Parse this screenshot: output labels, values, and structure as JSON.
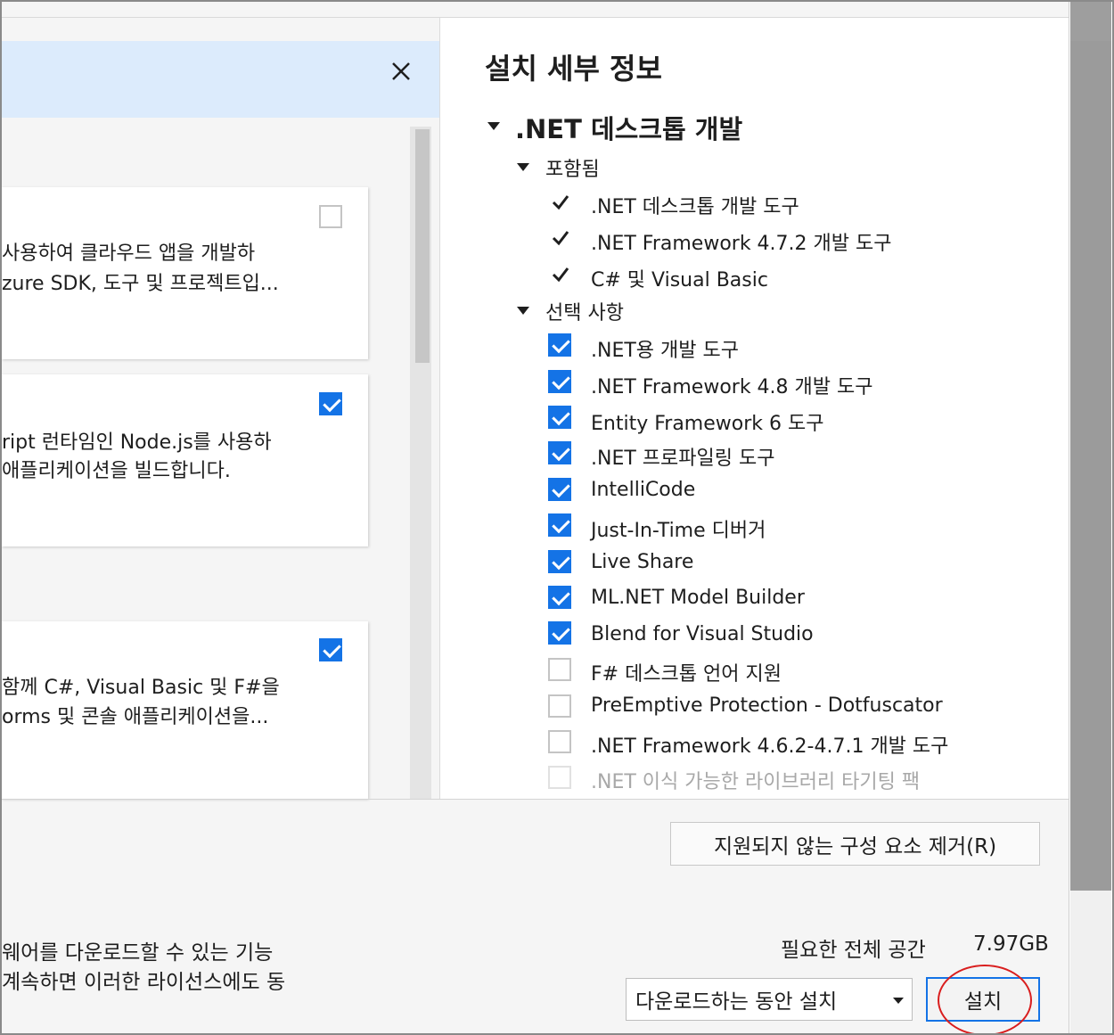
{
  "left": {
    "cards": [
      {
        "lines": [
          "사용하여 클라우드 앱을 개발하",
          "zure SDK, 도구 및 프로젝트입..."
        ],
        "checked": false
      },
      {
        "lines": [
          "ript 런타임인 Node.js를 사용하",
          "애플리케이션을 빌드합니다."
        ],
        "checked": true
      },
      {
        "lines": [
          "함께 C#, Visual Basic 및 F#을",
          "orms 및 콘솔 애플리케이션을..."
        ],
        "checked": true
      }
    ],
    "license_lines": [
      "웨어를 다운로드할 수 있는 기능",
      "계속하면 이러한 라이선스에도 동"
    ]
  },
  "details": {
    "title": "설치 세부 정보",
    "group": ".NET 데스크톱 개발",
    "included_label": "포함됨",
    "included": [
      ".NET 데스크톱 개발 도구",
      ".NET Framework 4.7.2 개발 도구",
      "C# 및 Visual Basic"
    ],
    "optional_label": "선택 사항",
    "optional": [
      {
        "label": ".NET용 개발 도구",
        "checked": true
      },
      {
        "label": ".NET Framework 4.8 개발 도구",
        "checked": true
      },
      {
        "label": "Entity Framework 6 도구",
        "checked": true
      },
      {
        "label": ".NET 프로파일링 도구",
        "checked": true
      },
      {
        "label": "IntelliCode",
        "checked": true
      },
      {
        "label": "Just-In-Time 디버거",
        "checked": true
      },
      {
        "label": "Live Share",
        "checked": true
      },
      {
        "label": "ML.NET Model Builder",
        "checked": true
      },
      {
        "label": "Blend for Visual Studio",
        "checked": true
      },
      {
        "label": "F# 데스크톱 언어 지원",
        "checked": false
      },
      {
        "label": "PreEmptive Protection - Dotfuscator",
        "checked": false
      },
      {
        "label": ".NET Framework 4.6.2-4.7.1 개발 도구",
        "checked": false
      },
      {
        "label": ".NET 이식 가능한 라이브러리 타기팅 팩",
        "checked": false
      }
    ]
  },
  "footer": {
    "remove_button": "지원되지 않는 구성 요소 제거(R)",
    "space_label": "필요한 전체 공간",
    "space_value": "7.97GB",
    "install_mode": "다운로드하는 동안 설치",
    "install_button": "설치"
  },
  "colors": {
    "accent": "#1473e6",
    "notice_bg": "#dcebfc",
    "highlight": "#d91e1e"
  }
}
